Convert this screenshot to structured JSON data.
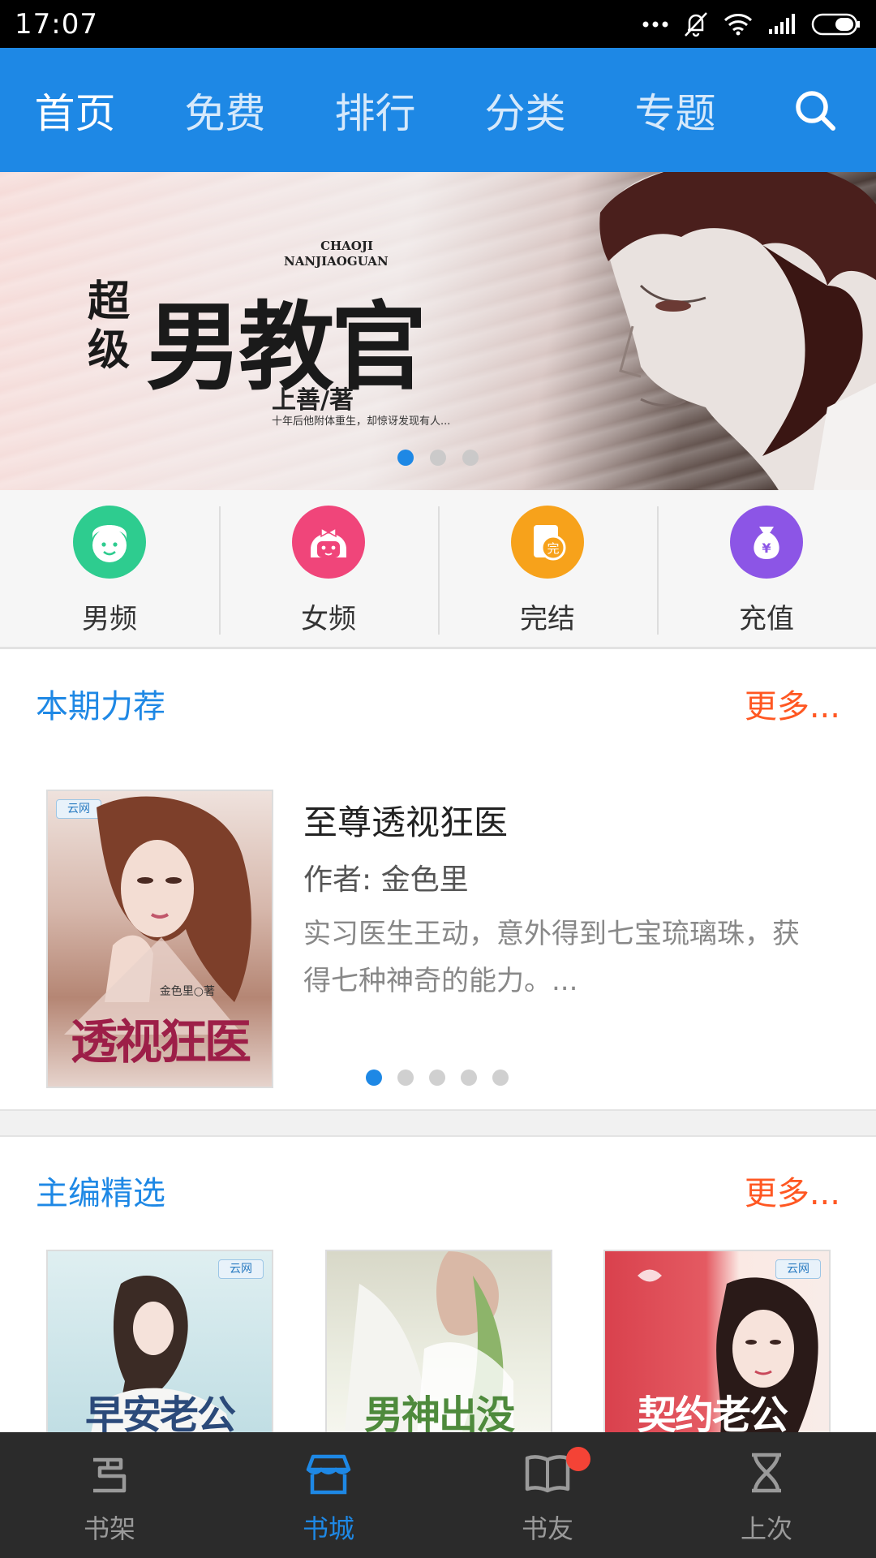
{
  "status_bar": {
    "time": "17:07",
    "icons": [
      "dots-icon",
      "mute-bell-icon",
      "wifi-icon",
      "signal-icon",
      "battery-icon"
    ]
  },
  "top_nav": {
    "tabs": [
      {
        "label": "首页",
        "active": true
      },
      {
        "label": "免费",
        "active": false
      },
      {
        "label": "排行",
        "active": false
      },
      {
        "label": "分类",
        "active": false
      },
      {
        "label": "专题",
        "active": false
      }
    ],
    "search_icon": "search-icon"
  },
  "banner": {
    "prefix": "超级",
    "title": "男教官",
    "pinyin_line1": "CHAOJI",
    "pinyin_line2": "NANJIAOGUAN",
    "author": "上善/著",
    "tagline": "十年后他附体重生，却惊讶发现有人...",
    "slides": 3,
    "active_slide": 0
  },
  "channels": [
    {
      "label": "男频",
      "icon": "boy-face-icon",
      "color": "#2ecc8f"
    },
    {
      "label": "女频",
      "icon": "girl-face-icon",
      "color": "#f0457a"
    },
    {
      "label": "完结",
      "icon": "complete-book-icon",
      "color": "#f7a21b"
    },
    {
      "label": "充值",
      "icon": "money-bag-icon",
      "color": "#8c55e6"
    }
  ],
  "recommend": {
    "title": "本期力荐",
    "more": "更多...",
    "book": {
      "title": "至尊透视狂医",
      "author": "作者: 金色里",
      "desc": "实习医生王动，意外得到七宝琉璃珠，获得七种神奇的能力。...",
      "cover_title": "透视狂医",
      "cover_author": "金色里○著",
      "cover_badge": "云网"
    },
    "slides": 5,
    "active_slide": 0
  },
  "editor_pick": {
    "title": "主编精选",
    "more": "更多...",
    "books": [
      {
        "cover_title": "早安老公",
        "badge": "云网"
      },
      {
        "cover_title": "男神出没",
        "badge": ""
      },
      {
        "cover_title": "契约老公",
        "badge": "云网"
      }
    ]
  },
  "bottom_nav": {
    "items": [
      {
        "label": "书架",
        "icon": "bookshelf-icon",
        "active": false
      },
      {
        "label": "书城",
        "icon": "store-icon",
        "active": true
      },
      {
        "label": "书友",
        "icon": "open-book-icon",
        "active": false,
        "badge": true
      },
      {
        "label": "上次",
        "icon": "hourglass-icon",
        "active": false
      }
    ]
  },
  "colors": {
    "primary": "#1e88e5",
    "more": "#ff5722",
    "bottom_bg": "#2b2b2b"
  }
}
